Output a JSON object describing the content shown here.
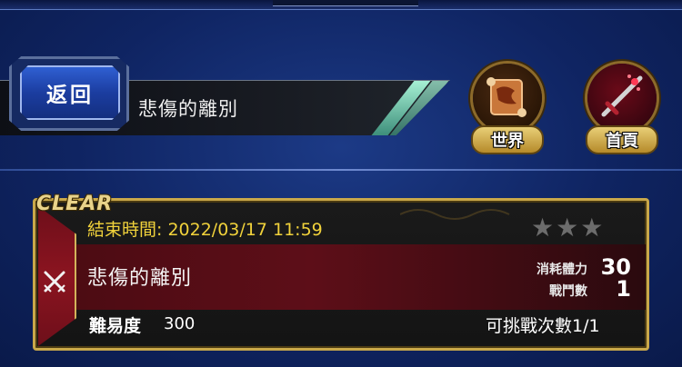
{
  "header": {
    "back_label": "返回",
    "title": "悲傷的離別"
  },
  "nav": [
    {
      "label": "世界",
      "icon": "scroll-icon"
    },
    {
      "label": "首頁",
      "icon": "sword-icon"
    }
  ],
  "quest": {
    "status_tag": "CLEAR",
    "end_time": "結束時間: 2022/03/17 11:59",
    "stars_filled": 0,
    "stars_total": 3,
    "name": "悲傷的離別",
    "stamina_label": "消耗體力",
    "stamina_value": "30",
    "battles_label": "戰鬥數",
    "battles_value": "1",
    "difficulty_label": "難易度",
    "difficulty_value": "300",
    "attempts": "可挑戰次數1/1"
  },
  "colors": {
    "background": "#14307a",
    "card_border": "#c9a84a",
    "end_time": "#f1d23b",
    "accent_stripe": "#a6f0d4"
  }
}
